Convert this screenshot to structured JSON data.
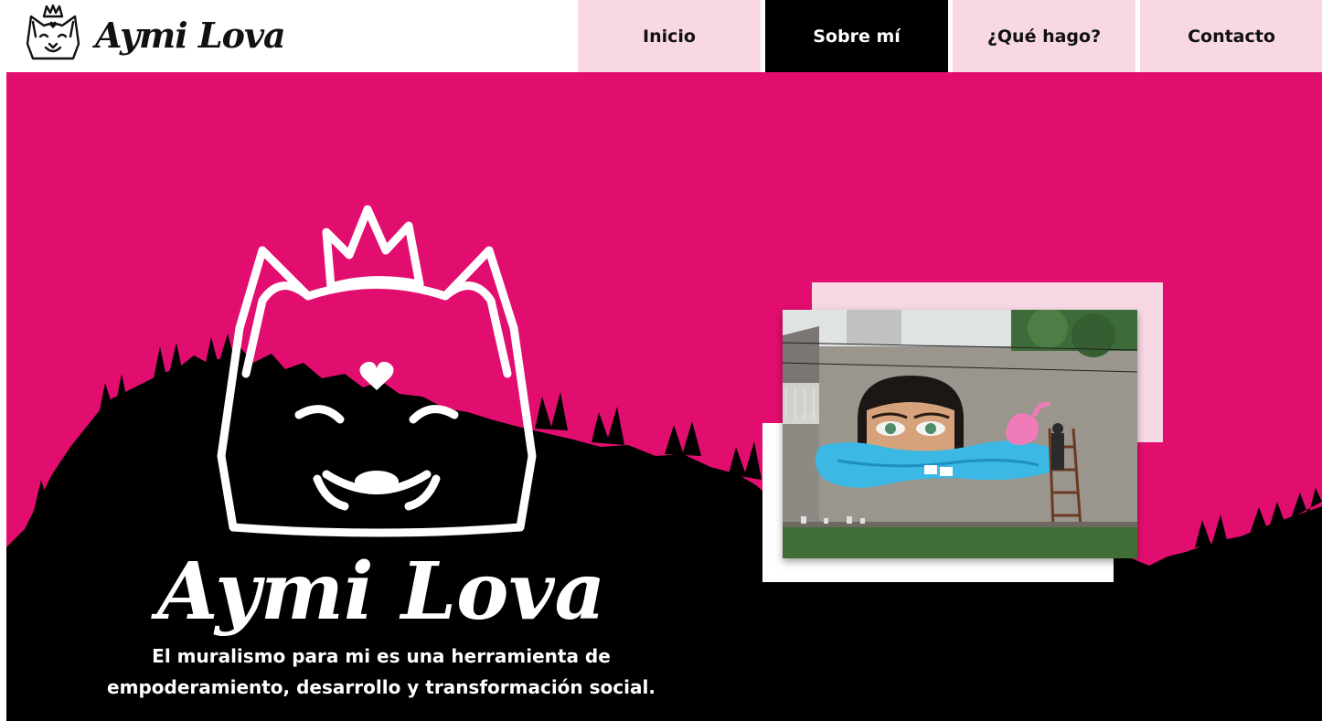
{
  "brand": {
    "name": "Aymi Lova",
    "logo_icon": "crowned-fox-icon"
  },
  "nav": {
    "items": [
      {
        "label": "Inicio",
        "active": false
      },
      {
        "label": "Sobre mí",
        "active": true
      },
      {
        "label": "¿Qué hago?",
        "active": false
      },
      {
        "label": "Contacto",
        "active": false
      }
    ]
  },
  "hero": {
    "logo_text": "Aymi Lova",
    "logo_icon": "crowned-fox-icon",
    "tagline_line1": "El muralismo para mi es una herramienta de",
    "tagline_line2": "empoderamiento, desarrollo y transformación social.",
    "photo_subject": "mural-photo"
  },
  "colors": {
    "brand_pink": "#e20e6f",
    "light_pink": "#f7d8e4",
    "black": "#000000",
    "white": "#ffffff"
  }
}
